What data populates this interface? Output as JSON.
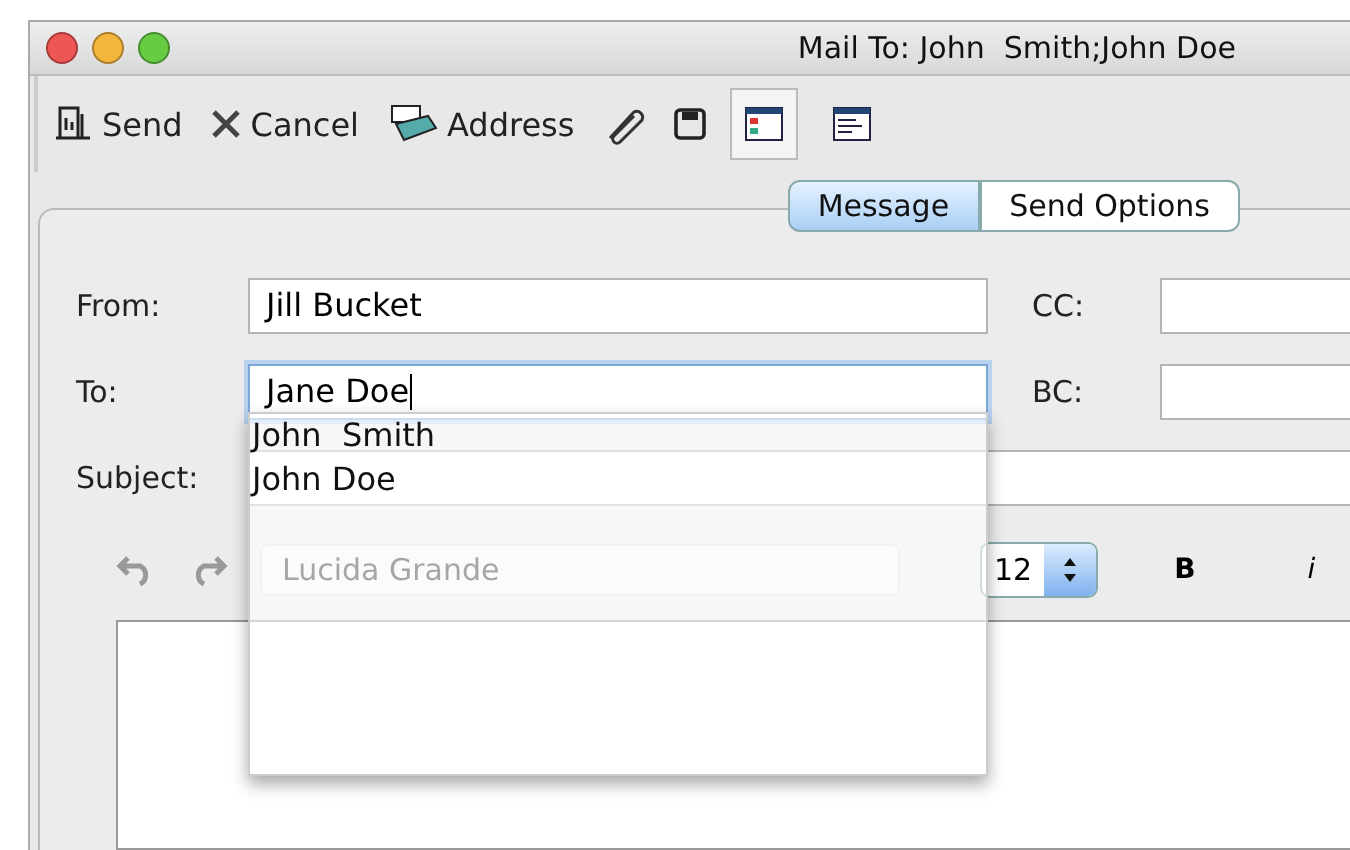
{
  "window": {
    "title": "Mail To: John  Smith;John Doe"
  },
  "toolbar": [
    {
      "kind": "send",
      "label": "Send"
    },
    {
      "kind": "cancel",
      "label": "Cancel"
    },
    {
      "kind": "address",
      "label": "Address"
    },
    {
      "kind": "attach"
    },
    {
      "kind": "save"
    },
    {
      "kind": "view-a",
      "selected": true
    },
    {
      "kind": "view-b",
      "selected": false
    }
  ],
  "tabs": [
    {
      "label": "Message",
      "selected": true
    },
    {
      "label": "Send Options",
      "selected": false
    }
  ],
  "fields": {
    "from": {
      "label": "From:",
      "value": "Jill Bucket"
    },
    "cc": {
      "label": "CC:"
    },
    "to": {
      "label": "To:",
      "value": "Jane Doe"
    },
    "bc": {
      "label": "BC:"
    },
    "subject": {
      "label": "Subject:"
    }
  },
  "suggestions": [
    {
      "label": "John  Smith"
    },
    {
      "label": "John Doe"
    }
  ],
  "format": {
    "font": "Lucida Grande",
    "size": "12",
    "bold": "B",
    "italic": "i"
  }
}
